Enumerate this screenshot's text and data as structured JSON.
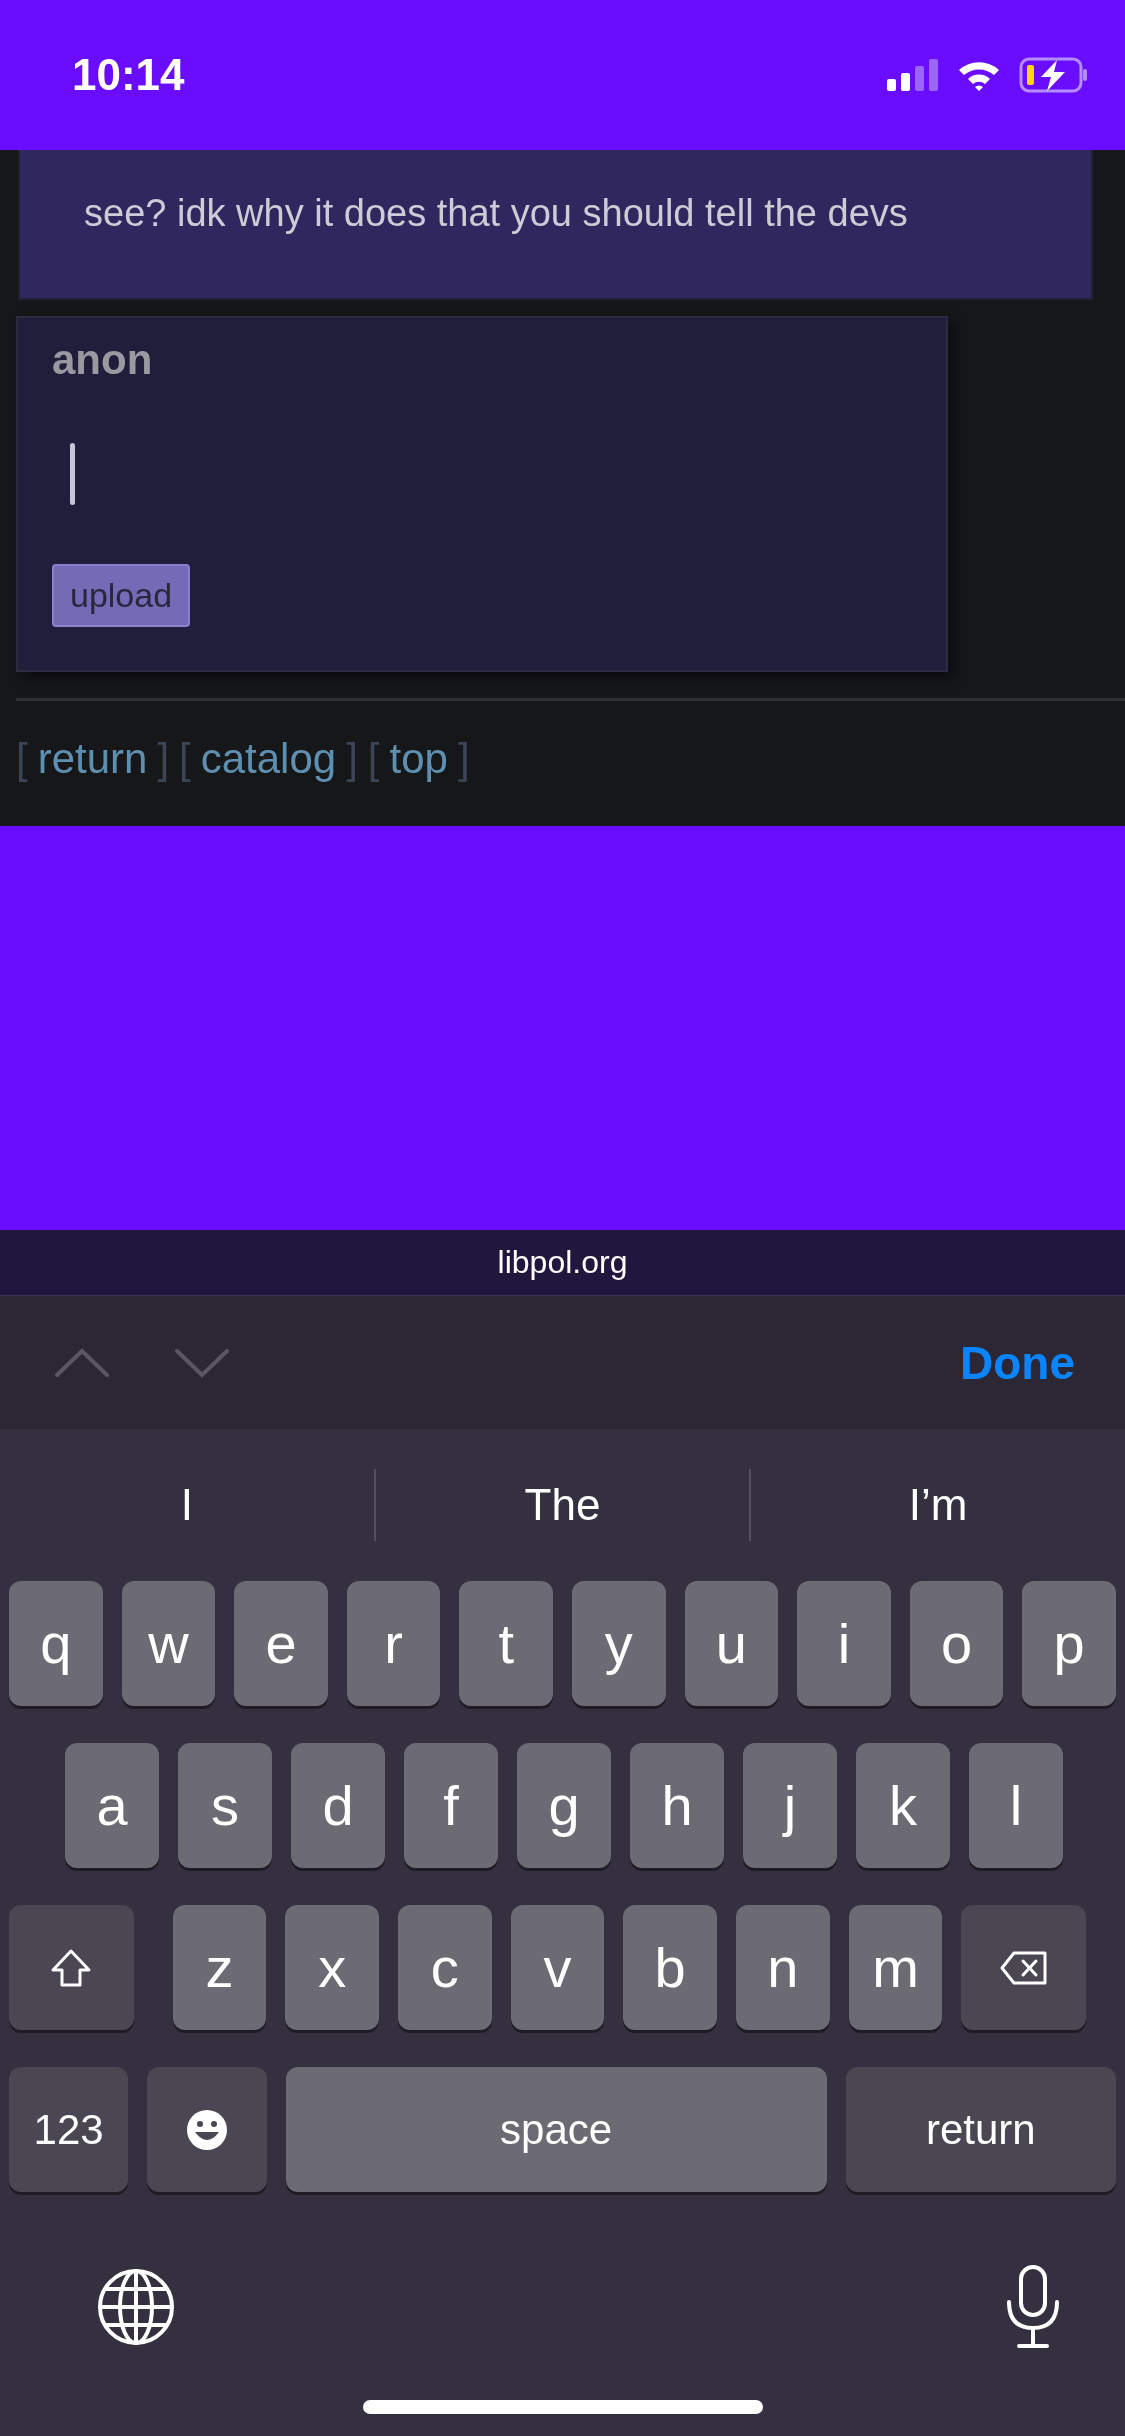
{
  "status_bar": {
    "time": "10:14"
  },
  "post": {
    "text": "see? idk why it does that you should tell the devs"
  },
  "reply": {
    "name": "anon",
    "upload": "upload"
  },
  "nav": [
    {
      "open": "[",
      "label": "return",
      "close": "]"
    },
    {
      "open": "[",
      "label": "catalog",
      "close": "]"
    },
    {
      "open": "[",
      "label": "top",
      "close": "]"
    }
  ],
  "url_bar": {
    "url": "libpol.org"
  },
  "accessory_bar": {
    "done": "Done"
  },
  "suggestions": [
    "I",
    "The",
    "I’m"
  ],
  "keyboard": [
    [
      {
        "kind": "letter",
        "label": "q"
      },
      {
        "kind": "letter",
        "label": "w"
      },
      {
        "kind": "letter",
        "label": "e"
      },
      {
        "kind": "letter",
        "label": "r"
      },
      {
        "kind": "letter",
        "label": "t"
      },
      {
        "kind": "letter",
        "label": "y"
      },
      {
        "kind": "letter",
        "label": "u"
      },
      {
        "kind": "letter",
        "label": "i"
      },
      {
        "kind": "letter",
        "label": "o"
      },
      {
        "kind": "letter",
        "label": "p"
      }
    ],
    [
      {
        "kind": "letter",
        "label": "a"
      },
      {
        "kind": "letter",
        "label": "s"
      },
      {
        "kind": "letter",
        "label": "d"
      },
      {
        "kind": "letter",
        "label": "f"
      },
      {
        "kind": "letter",
        "label": "g"
      },
      {
        "kind": "letter",
        "label": "h"
      },
      {
        "kind": "letter",
        "label": "j"
      },
      {
        "kind": "letter",
        "label": "k"
      },
      {
        "kind": "letter",
        "label": "l"
      }
    ],
    [
      {
        "kind": "shift"
      },
      {
        "kind": "letter",
        "label": "z"
      },
      {
        "kind": "letter",
        "label": "x"
      },
      {
        "kind": "letter",
        "label": "c"
      },
      {
        "kind": "letter",
        "label": "v"
      },
      {
        "kind": "letter",
        "label": "b"
      },
      {
        "kind": "letter",
        "label": "n"
      },
      {
        "kind": "letter",
        "label": "m"
      },
      {
        "kind": "delete"
      }
    ],
    [
      {
        "kind": "mode",
        "label": "123"
      },
      {
        "kind": "emoji"
      },
      {
        "kind": "space",
        "label": "space"
      },
      {
        "kind": "return",
        "label": "return"
      }
    ]
  ]
}
